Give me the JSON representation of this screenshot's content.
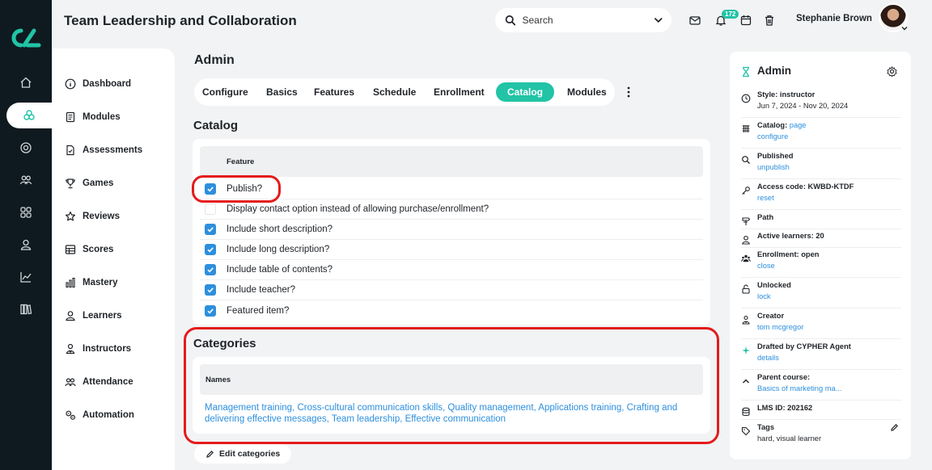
{
  "app": {
    "title": "Team Leadership and Collaboration"
  },
  "header": {
    "search_placeholder": "Search",
    "notifications_count": "172",
    "user_name": "Stephanie Brown"
  },
  "sidebar": {
    "items": [
      {
        "label": "Dashboard",
        "icon": "info-icon"
      },
      {
        "label": "Modules",
        "icon": "book-icon"
      },
      {
        "label": "Assessments",
        "icon": "document-icon"
      },
      {
        "label": "Games",
        "icon": "trophy-icon"
      },
      {
        "label": "Reviews",
        "icon": "star-icon"
      },
      {
        "label": "Scores",
        "icon": "table-icon"
      },
      {
        "label": "Mastery",
        "icon": "bars-icon"
      },
      {
        "label": "Learners",
        "icon": "user-icon"
      },
      {
        "label": "Instructors",
        "icon": "instructor-icon"
      },
      {
        "label": "Attendance",
        "icon": "people-icon"
      },
      {
        "label": "Automation",
        "icon": "gears-icon"
      }
    ]
  },
  "main": {
    "title": "Admin",
    "tabs": [
      "Configure",
      "Basics",
      "Features",
      "Schedule",
      "Enrollment",
      "Catalog",
      "Modules"
    ],
    "active_tab": "Catalog",
    "catalog": {
      "heading": "Catalog",
      "column_header": "Feature",
      "features": [
        {
          "label": "Publish?",
          "checked": true
        },
        {
          "label": "Display contact option instead of allowing purchase/enrollment?",
          "checked": false
        },
        {
          "label": "Include short description?",
          "checked": true
        },
        {
          "label": "Include long description?",
          "checked": true
        },
        {
          "label": "Include table of contents?",
          "checked": true
        },
        {
          "label": "Include teacher?",
          "checked": true
        },
        {
          "label": "Featured item?",
          "checked": true
        }
      ]
    },
    "categories": {
      "heading": "Categories",
      "column_header": "Names",
      "names": [
        "Management training",
        "Cross-cultural communication skills",
        "Quality management",
        "Applications training",
        "Crafting and delivering effective messages",
        "Team leadership",
        "Effective communication"
      ],
      "edit_label": "Edit categories"
    }
  },
  "panel": {
    "title": "Admin",
    "items": [
      {
        "icon": "calendar-clock-icon",
        "label": "Style: instructor",
        "sub": "Jun 7, 2024 - Nov 20, 2024"
      },
      {
        "icon": "grid-icon",
        "label": "Catalog: ",
        "inline_link": "page",
        "link": "configure"
      },
      {
        "icon": "search-icon",
        "label": "Published",
        "link": "unpublish"
      },
      {
        "icon": "key-icon",
        "label": "Access code: KWBD-KTDF",
        "link": "reset"
      },
      {
        "icon": "path-icon",
        "label": "Path"
      },
      {
        "icon": "user-icon",
        "label": "Active learners: 20"
      },
      {
        "icon": "group-icon",
        "label": "Enrollment: open",
        "link": "close"
      },
      {
        "icon": "unlock-icon",
        "label": "Unlocked",
        "link": "lock"
      },
      {
        "icon": "creator-icon",
        "label": "Creator",
        "link": "tom mcgregor"
      },
      {
        "icon": "sparkle-icon",
        "label": "Drafted by CYPHER Agent",
        "link": "details"
      },
      {
        "icon": "chevron-up-icon",
        "label": "Parent course:",
        "link": "Basics of marketing ma..."
      },
      {
        "icon": "database-icon",
        "label": "LMS ID: 202162"
      },
      {
        "icon": "tag-icon",
        "label": "Tags",
        "sub": "hard, visual learner"
      }
    ]
  },
  "colors": {
    "accent": "#22c3a6",
    "link": "#2d8fdd",
    "checkbox": "#2d8fdd",
    "highlight": "#e41b1b",
    "rail": "#0e1a20"
  }
}
